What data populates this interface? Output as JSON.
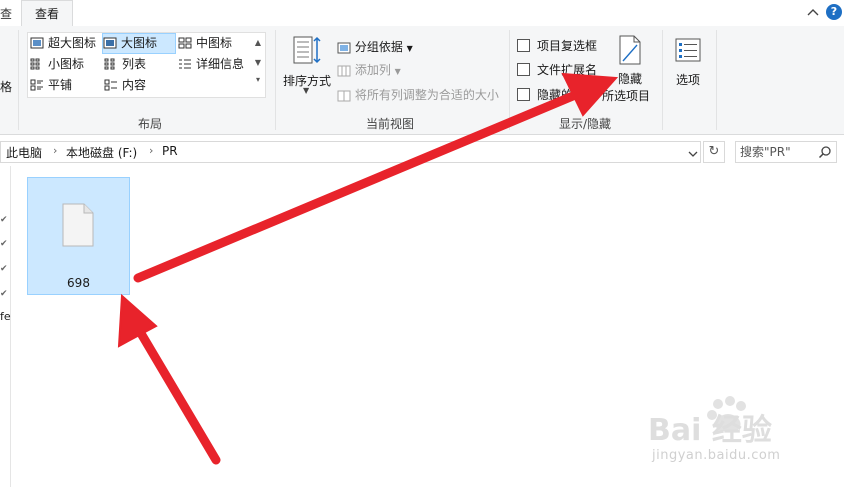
{
  "tabs": {
    "partial_tab": "查",
    "view_tab": "查看"
  },
  "ribbon": {
    "layout": {
      "group_label": "布局",
      "items": {
        "extra_large": "超大图标",
        "large": "大图标",
        "medium": "中图标",
        "small": "小图标",
        "list": "列表",
        "details": "详细信息",
        "tiles": "平铺",
        "content": "内容"
      },
      "left_partial": "格",
      "selected_item": "大图标"
    },
    "current_view": {
      "group_label": "当前视图",
      "sort_by": "排序方式",
      "group_by": "分组依据",
      "add_columns": "添加列",
      "fit_columns": "将所有列调整为合适的大小"
    },
    "show_hide": {
      "group_label": "显示/隐藏",
      "item_checkboxes": "项目复选框",
      "file_extensions": "文件扩展名",
      "hidden_items": "隐藏的项目",
      "hide_selected_line1": "隐藏",
      "hide_selected_line2": "所选项目"
    },
    "options_label": "选项"
  },
  "address_bar": {
    "crumbs": [
      "此电脑",
      "本地磁盘 (F:)",
      "PR"
    ],
    "search_placeholder": "搜索\"PR\""
  },
  "nav_pane": {
    "partial_text": "fe"
  },
  "files": [
    {
      "name": "698"
    }
  ],
  "watermark": {
    "brand": "Bai 经验",
    "url": "jingyan.baidu.com"
  },
  "colors": {
    "selection_bg": "#cce8ff",
    "selection_border": "#99d1ff",
    "arrow_red": "#e8232b",
    "accent_blue": "#1e6fc4"
  }
}
